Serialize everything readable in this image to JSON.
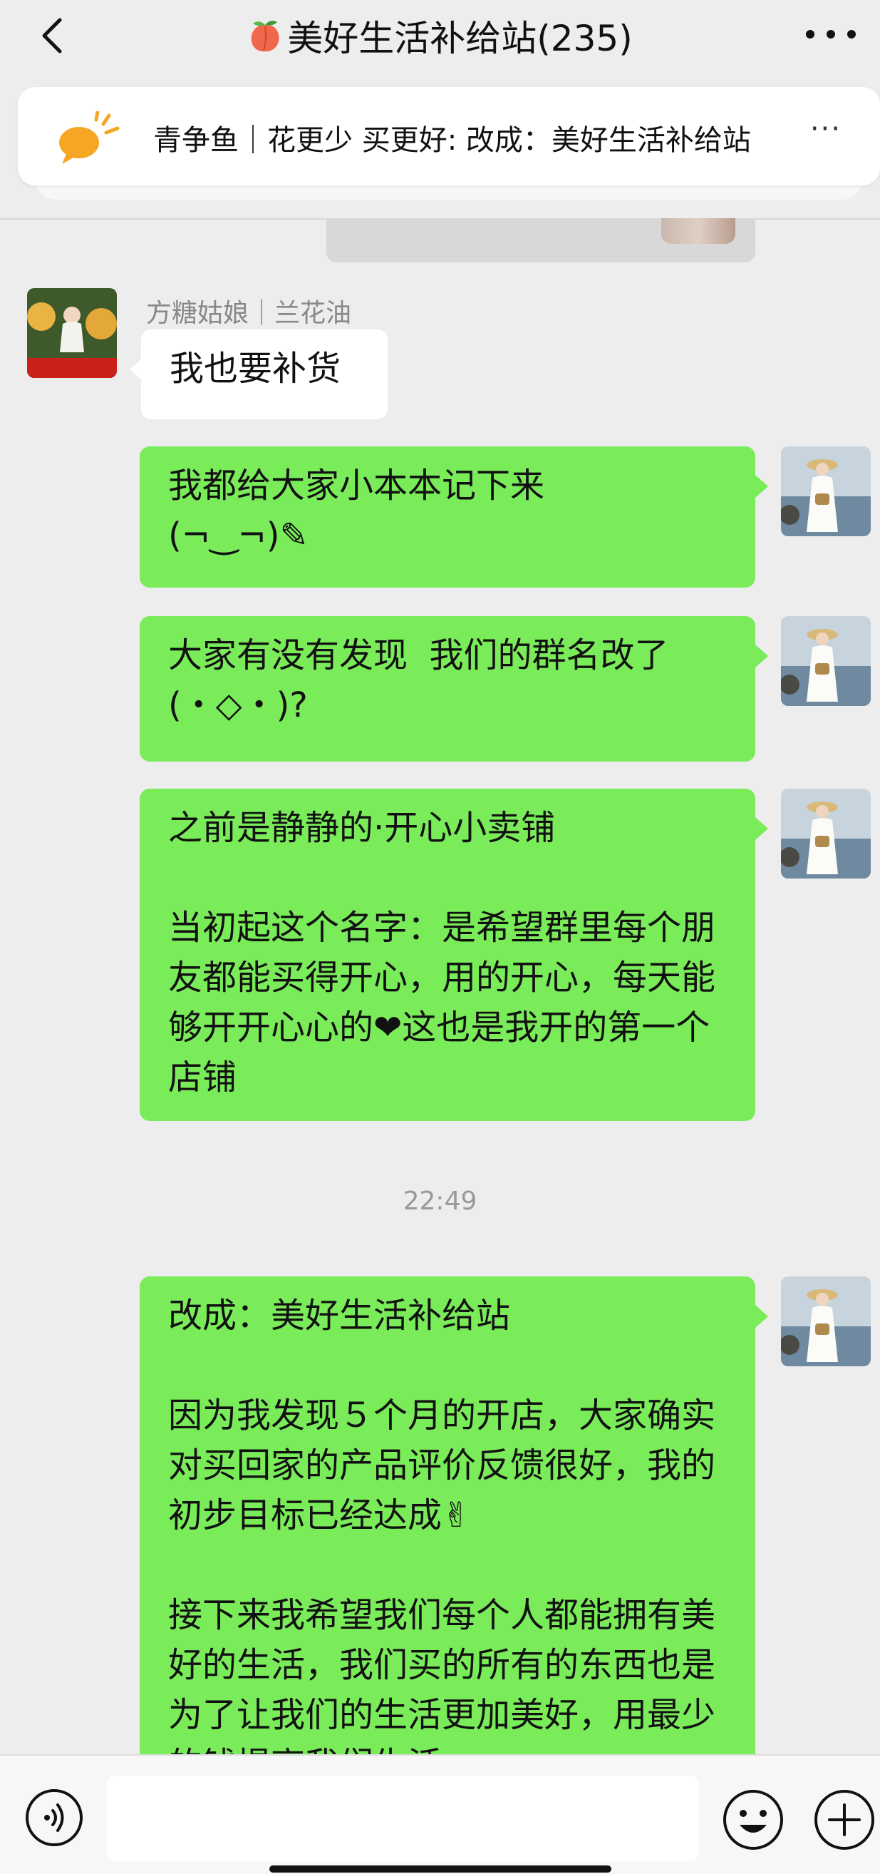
{
  "header": {
    "title": "美好生活补给站(235)",
    "icon_title": "peach-emoji",
    "back_icon": "chevron-left-icon",
    "more_icon": "more-dots-icon"
  },
  "notice": {
    "icon": "megaphone-icon",
    "text": "青争鱼｜花更少 买更好: 改成：美好生活补给站",
    "more": "···"
  },
  "messages": [
    {
      "sender": "方糖姑娘｜兰花油",
      "text": "我也要补货",
      "side": "left"
    },
    {
      "text": "我都给大家小本本记下来\n(¬‿¬)✎",
      "side": "right"
    },
    {
      "text": "大家有没有发现  我们的群名改了\n(・◇・)?",
      "side": "right"
    },
    {
      "text": "之前是静静的·开心小卖铺\n\n当初起这个名字：是希望群里每个朋友都能买得开心，用的开心，每天能够开开心心的❤这也是我开的第一个店铺",
      "side": "right"
    },
    {
      "text": "改成：美好生活补给站\n\n因为我发现５个月的开店，大家确实对买回家的产品评价反馈很好，我的初步目标已经达成✌\n\n接下来我希望我们每个人都能拥有美好的生活，我们买的所有的东西也是为了让我们的生活更加美好，用最少的钱提高我们生活",
      "side": "right"
    }
  ],
  "timestamp": "22:49",
  "bottom": {
    "voice_icon": "voice-icon",
    "emoji_icon": "emoji-icon",
    "plus_icon": "plus-icon",
    "input_value": ""
  },
  "colors": {
    "background": "#ededed",
    "green_bubble": "#7aec5a",
    "white_bubble": "#ffffff",
    "notice_icon": "#f5a623"
  }
}
